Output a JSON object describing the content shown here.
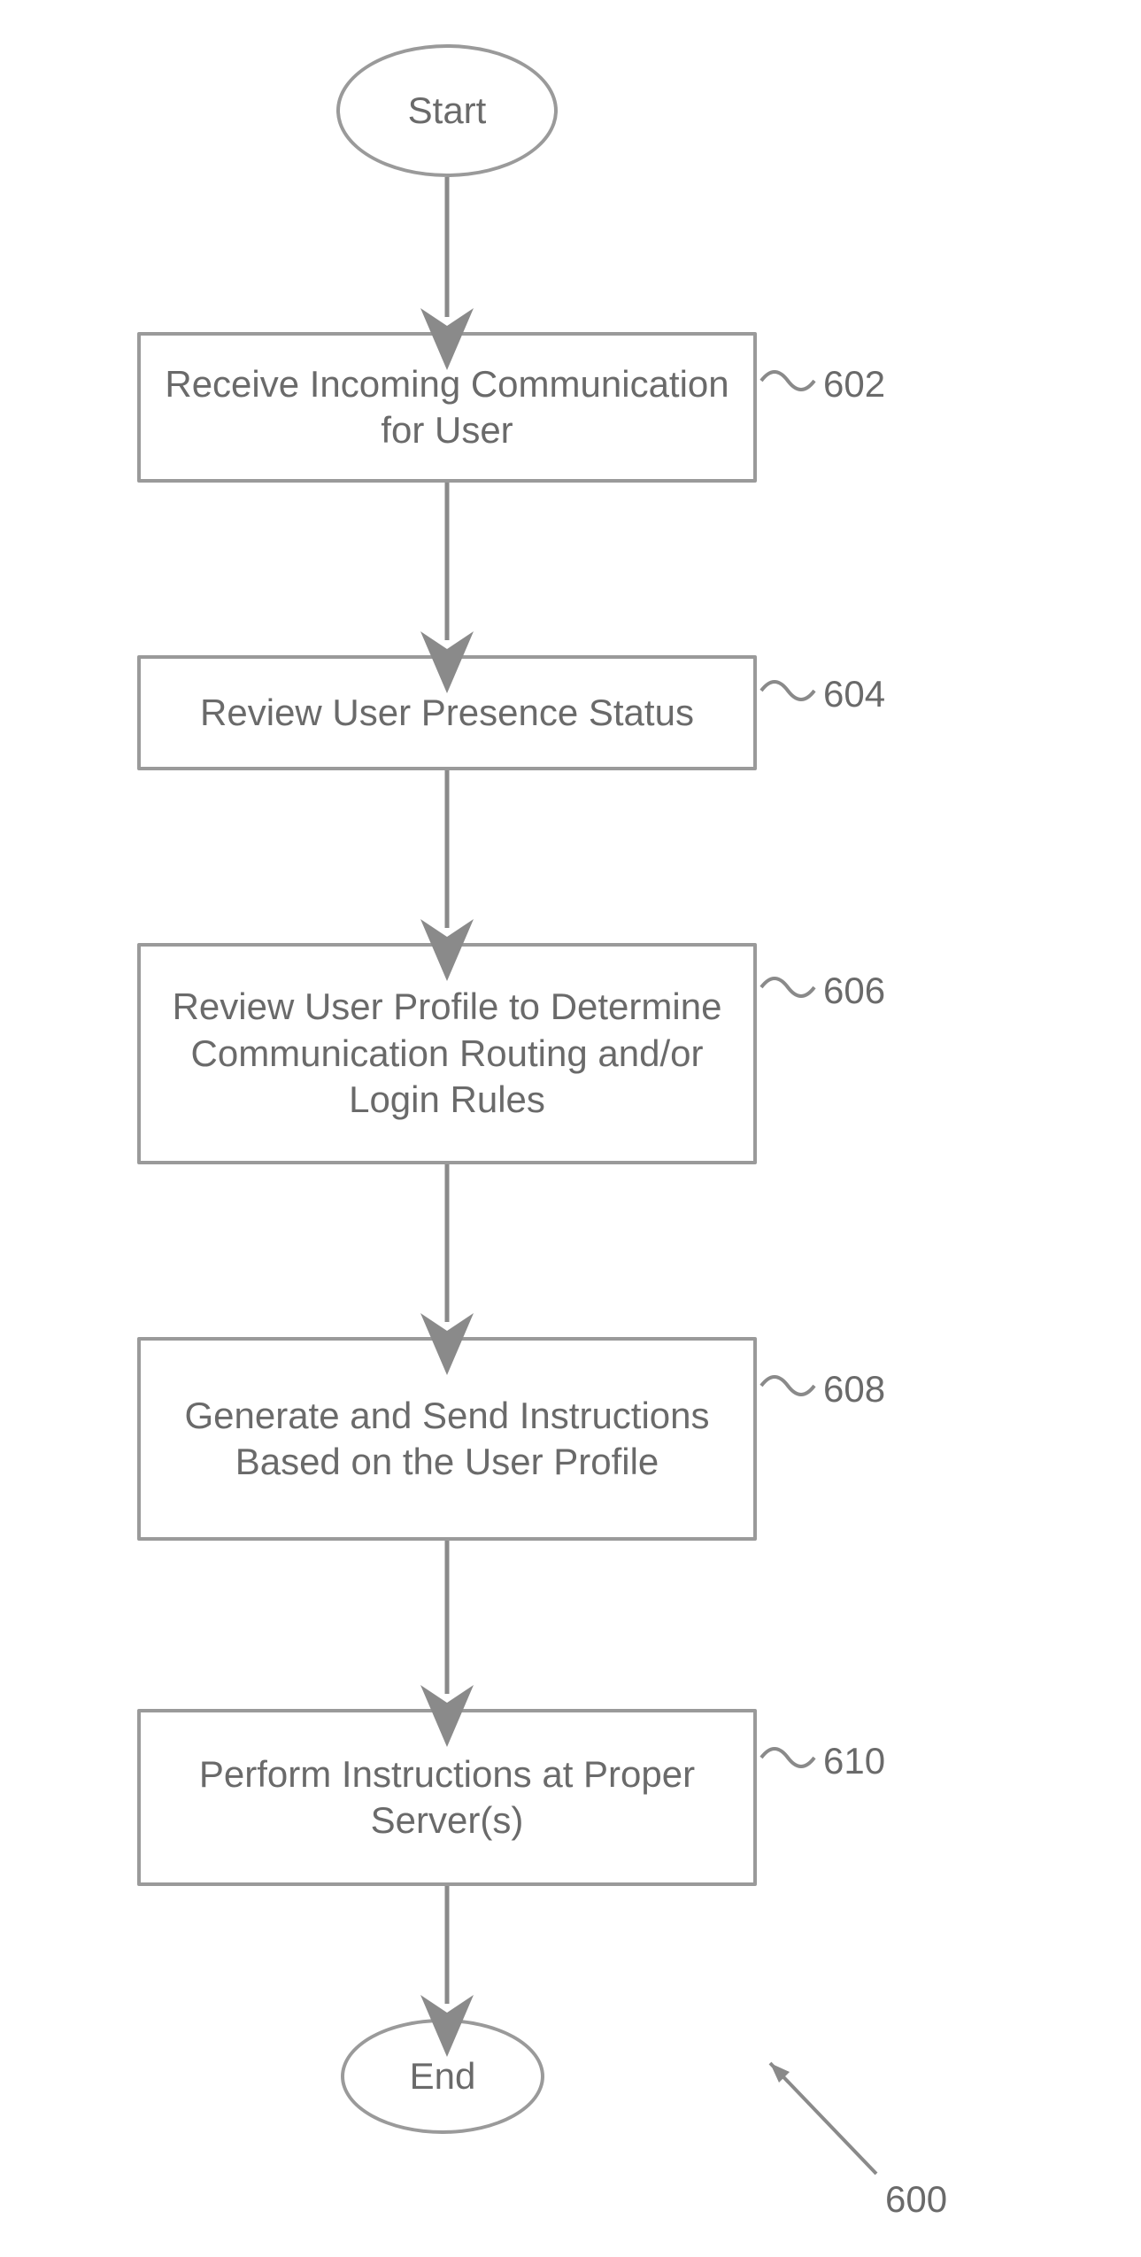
{
  "flow": {
    "start": "Start",
    "end": "End",
    "steps": [
      {
        "text": "Receive Incoming Communication for User",
        "ref": "602"
      },
      {
        "text": "Review User Presence Status",
        "ref": "604"
      },
      {
        "text": "Review User Profile to Determine Communication Routing and/or Login Rules",
        "ref": "606"
      },
      {
        "text": "Generate and Send Instructions Based on the User Profile",
        "ref": "608"
      },
      {
        "text": "Perform Instructions at Proper Server(s)",
        "ref": "610"
      }
    ],
    "figure_ref": "600"
  }
}
